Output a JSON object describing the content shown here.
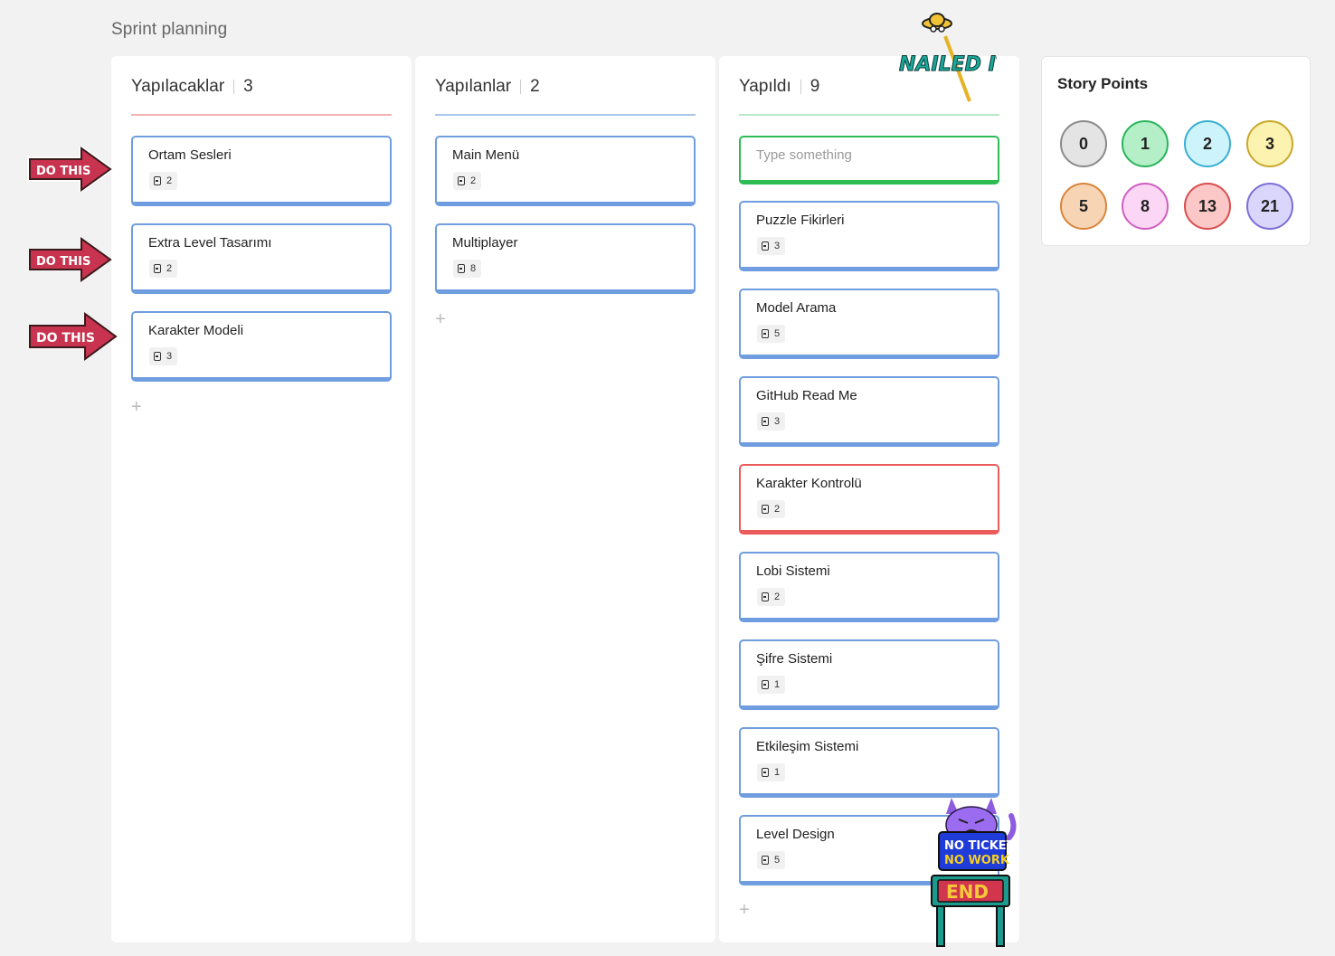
{
  "board": {
    "title": "Sprint planning"
  },
  "columns": [
    {
      "title": "Yapılacaklar",
      "count": "3",
      "line_color": "#f3b3b3",
      "cards": [
        {
          "title": "Ortam Sesleri",
          "points": "2",
          "border": "#6f9ddf"
        },
        {
          "title": "Extra Level Tasarımı",
          "points": "2",
          "border": "#6f9ddf"
        },
        {
          "title": "Karakter Modeli",
          "points": "3",
          "border": "#6f9ddf"
        }
      ],
      "add_label": "+"
    },
    {
      "title": "Yapılanlar",
      "count": "2",
      "line_color": "#a9c6ee",
      "cards": [
        {
          "title": "Main Menü",
          "points": "2",
          "border": "#6f9ddf"
        },
        {
          "title": "Multiplayer",
          "points": "8",
          "border": "#6f9ddf"
        }
      ],
      "add_label": "+"
    },
    {
      "title": "Yapıldı",
      "count": "9",
      "line_color": "#b9e8c6",
      "input_placeholder": "Type something",
      "input_border": "#2dbb54",
      "cards": [
        {
          "title": "Puzzle Fikirleri",
          "points": "3",
          "border": "#6f9ddf"
        },
        {
          "title": "Model Arama",
          "points": "5",
          "border": "#6f9ddf"
        },
        {
          "title": "GitHub Read Me",
          "points": "3",
          "border": "#6f9ddf"
        },
        {
          "title": "Karakter Kontrolü",
          "points": "2",
          "border": "#ec5b5b"
        },
        {
          "title": "Lobi Sistemi",
          "points": "2",
          "border": "#6f9ddf"
        },
        {
          "title": "Şifre Sistemi",
          "points": "1",
          "border": "#6f9ddf"
        },
        {
          "title": "Etkileşim Sistemi",
          "points": "1",
          "border": "#6f9ddf"
        },
        {
          "title": "Level Design",
          "points": "5",
          "border": "#6f9ddf"
        }
      ],
      "add_label": "+"
    }
  ],
  "story_points": {
    "title": "Story Points",
    "values": [
      {
        "label": "0",
        "fill": "#e4e4e4",
        "border": "#8a8a8a"
      },
      {
        "label": "1",
        "fill": "#b4efc8",
        "border": "#29b45a"
      },
      {
        "label": "2",
        "fill": "#cdf3fb",
        "border": "#3aaed0"
      },
      {
        "label": "3",
        "fill": "#fdf3b0",
        "border": "#c9a72a"
      },
      {
        "label": "5",
        "fill": "#f7d4b4",
        "border": "#d9853a"
      },
      {
        "label": "8",
        "fill": "#fbd6f5",
        "border": "#cf5fc0"
      },
      {
        "label": "13",
        "fill": "#fbc7c7",
        "border": "#d94d4d"
      },
      {
        "label": "21",
        "fill": "#dad6fb",
        "border": "#7b6fd6"
      }
    ]
  },
  "stickers": {
    "do_this": "DO THIS",
    "nailed_it": "NAILED IT!",
    "no_ticket_line1": "NO TICKET",
    "no_ticket_line2": "NO WORK",
    "end_sign": "END"
  },
  "colors": {
    "card_blue": "#6f9ddf",
    "card_red": "#ec5b5b",
    "card_green": "#2dbb54",
    "sticker_red": "#c8334f"
  }
}
